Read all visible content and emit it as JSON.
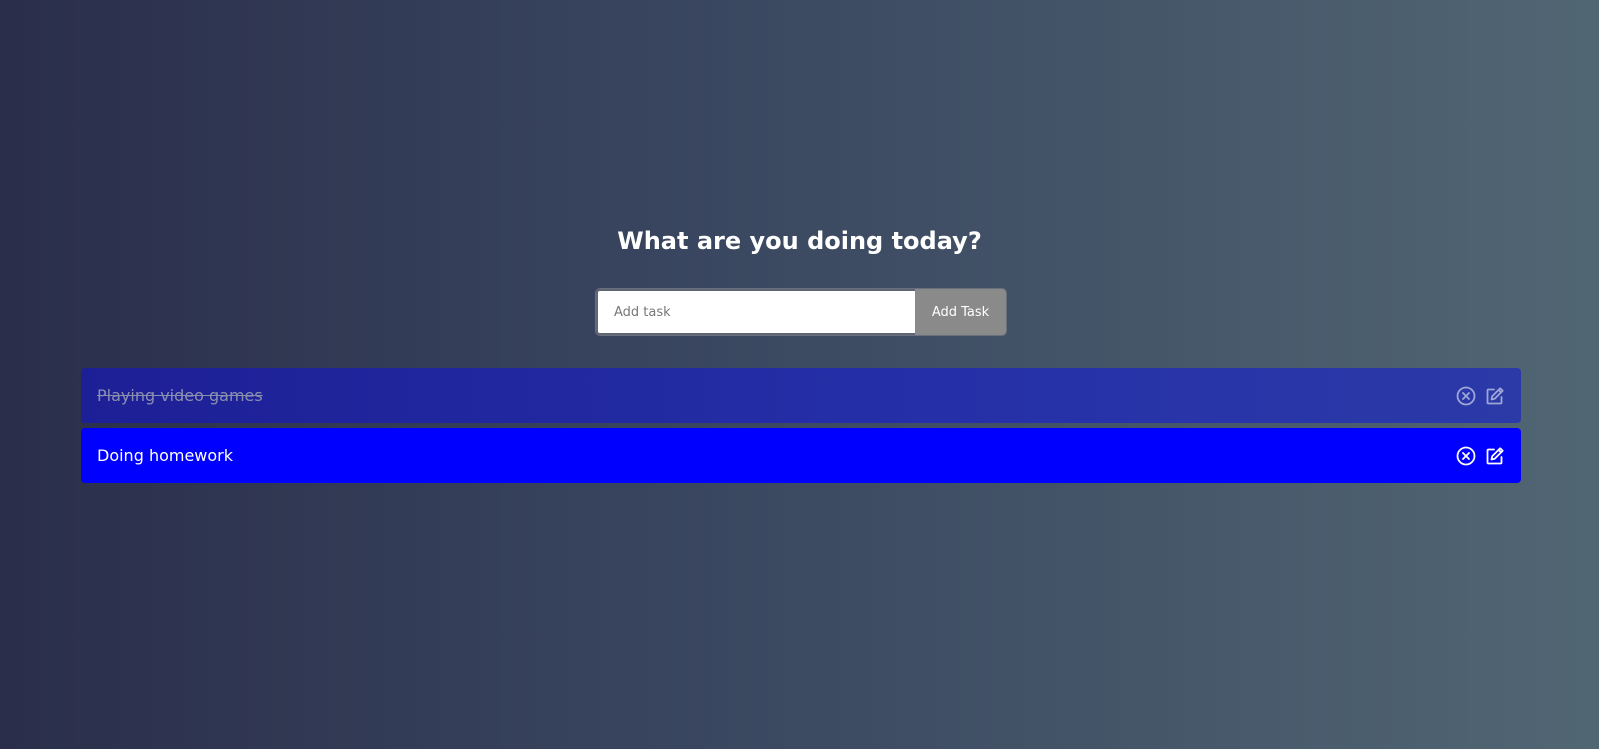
{
  "header": {
    "title": "What are you doing today?"
  },
  "form": {
    "input_value": "",
    "input_placeholder": "Add task",
    "add_button_label": "Add Task"
  },
  "tasks": [
    {
      "text": "Playing video games",
      "completed": true,
      "delete_icon": "close-circle-icon",
      "edit_icon": "edit-icon"
    },
    {
      "text": "Doing homework",
      "completed": false,
      "delete_icon": "close-circle-icon",
      "edit_icon": "edit-icon"
    }
  ],
  "colors": {
    "background_start": "#2a2e4a",
    "background_end": "#516673",
    "completed_task_bg": "#1d1f96",
    "active_task_bg": "#0000ff",
    "add_button_bg": "#8a8a8a"
  }
}
